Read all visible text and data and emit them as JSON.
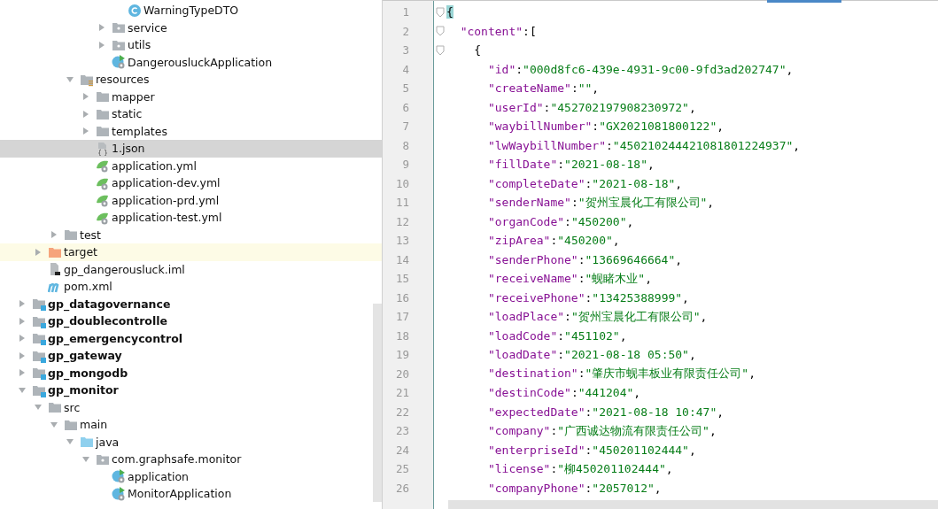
{
  "project_tree": [
    {
      "children": [
        {
          "children": [
            {
              "children": [
                {
                  "children": [
                    {
                      "children": [
                        {
                          "children": [
                            {
                              "label": "WarningTypeDTO",
                              "kind": "class",
                              "selected": false,
                              "highlighted": false
                            }
                          ]
                        },
                        {
                          "label": "service",
                          "kind": "package",
                          "expanded": false,
                          "selected": false,
                          "highlighted": false
                        },
                        {
                          "label": "utils",
                          "kind": "package",
                          "expanded": false,
                          "selected": false,
                          "highlighted": false
                        },
                        {
                          "label": "DangerousluckApplication",
                          "kind": "spring-class",
                          "selected": false,
                          "highlighted": false
                        }
                      ]
                    }
                  ]
                },
                {
                  "label": "resources",
                  "kind": "resources-folder",
                  "expanded": true,
                  "selected": false,
                  "highlighted": false,
                  "children": [
                    {
                      "label": "mapper",
                      "kind": "folder",
                      "expanded": false,
                      "selected": false,
                      "highlighted": false
                    },
                    {
                      "label": "static",
                      "kind": "folder",
                      "expanded": false,
                      "selected": false,
                      "highlighted": false
                    },
                    {
                      "label": "templates",
                      "kind": "folder",
                      "expanded": false,
                      "selected": false,
                      "highlighted": false
                    },
                    {
                      "label": "1.json",
                      "kind": "json",
                      "selected": true,
                      "highlighted": false
                    },
                    {
                      "label": "application.yml",
                      "kind": "spring-yml",
                      "selected": false,
                      "highlighted": false
                    },
                    {
                      "label": "application-dev.yml",
                      "kind": "spring-yml",
                      "selected": false,
                      "highlighted": false
                    },
                    {
                      "label": "application-prd.yml",
                      "kind": "spring-yml",
                      "selected": false,
                      "highlighted": false
                    },
                    {
                      "label": "application-test.yml",
                      "kind": "spring-yml",
                      "selected": false,
                      "highlighted": false
                    }
                  ]
                }
              ]
            },
            {
              "label": "test",
              "kind": "folder",
              "expanded": false,
              "selected": false,
              "highlighted": false
            }
          ]
        },
        {
          "label": "target",
          "kind": "excluded-folder",
          "expanded": false,
          "selected": false,
          "highlighted": true
        },
        {
          "label": "gp_dangerousluck.iml",
          "kind": "iml",
          "selected": false,
          "highlighted": false
        },
        {
          "label": "pom.xml",
          "kind": "maven",
          "selected": false,
          "highlighted": false
        }
      ]
    },
    {
      "label": "gp_datagovernance",
      "kind": "module",
      "expanded": false,
      "selected": false,
      "highlighted": false
    },
    {
      "label": "gp_doublecontrolle",
      "kind": "module",
      "expanded": false,
      "selected": false,
      "highlighted": false
    },
    {
      "label": "gp_emergencycontrol",
      "kind": "module",
      "expanded": false,
      "selected": false,
      "highlighted": false
    },
    {
      "label": "gp_gateway",
      "kind": "module",
      "expanded": false,
      "selected": false,
      "highlighted": false
    },
    {
      "label": "gp_mongodb",
      "kind": "module",
      "expanded": false,
      "selected": false,
      "highlighted": false
    },
    {
      "label": "gp_monitor",
      "kind": "module",
      "expanded": true,
      "selected": false,
      "highlighted": false,
      "children": [
        {
          "label": "src",
          "kind": "folder",
          "expanded": true,
          "selected": false,
          "highlighted": false,
          "children": [
            {
              "label": "main",
              "kind": "folder",
              "expanded": true,
              "selected": false,
              "highlighted": false,
              "children": [
                {
                  "label": "java",
                  "kind": "source-folder",
                  "expanded": true,
                  "selected": false,
                  "highlighted": false,
                  "children": [
                    {
                      "label": "com.graphsafe.monitor",
                      "kind": "package",
                      "expanded": true,
                      "selected": false,
                      "highlighted": false,
                      "children": [
                        {
                          "label": "application",
                          "kind": "spring-class",
                          "selected": false,
                          "highlighted": false
                        },
                        {
                          "label": "MonitorApplication",
                          "kind": "spring-class",
                          "selected": false,
                          "highlighted": false
                        }
                      ]
                    }
                  ]
                }
              ]
            }
          ]
        }
      ]
    }
  ],
  "editor": {
    "lines": [
      {
        "number": "1",
        "kind": "root-open",
        "tokens": [
          {
            "kind": "brace-match",
            "text": "{"
          }
        ]
      },
      {
        "number": "2",
        "kind": "array-open",
        "tokens": [
          {
            "kind": "key",
            "text": "\"content\""
          },
          {
            "kind": "punct",
            "text": ":["
          }
        ]
      },
      {
        "number": "3",
        "kind": "object-open",
        "tokens": [
          {
            "kind": "punct",
            "text": "{"
          }
        ]
      },
      {
        "number": "4",
        "kind": "field",
        "tokens": [
          {
            "kind": "key",
            "text": "\"id\""
          },
          {
            "kind": "punct",
            "text": ":"
          },
          {
            "kind": "value",
            "text": "\"000d8fc6-439e-4931-9c00-9fd3ad202747\""
          },
          {
            "kind": "punct",
            "text": ","
          }
        ]
      },
      {
        "number": "5",
        "kind": "field",
        "tokens": [
          {
            "kind": "key",
            "text": "\"createName\""
          },
          {
            "kind": "punct",
            "text": ":"
          },
          {
            "kind": "value",
            "text": "\"\""
          },
          {
            "kind": "punct",
            "text": ","
          }
        ]
      },
      {
        "number": "6",
        "kind": "field",
        "tokens": [
          {
            "kind": "key",
            "text": "\"userId\""
          },
          {
            "kind": "punct",
            "text": ":"
          },
          {
            "kind": "value",
            "text": "\"452702197908230972\""
          },
          {
            "kind": "punct",
            "text": ","
          }
        ]
      },
      {
        "number": "7",
        "kind": "field",
        "tokens": [
          {
            "kind": "key",
            "text": "\"waybillNumber\""
          },
          {
            "kind": "punct",
            "text": ":"
          },
          {
            "kind": "value",
            "text": "\"GX2021081800122\""
          },
          {
            "kind": "punct",
            "text": ","
          }
        ]
      },
      {
        "number": "8",
        "kind": "field",
        "tokens": [
          {
            "kind": "key",
            "text": "\"lwWaybillNumber\""
          },
          {
            "kind": "punct",
            "text": ":"
          },
          {
            "kind": "value",
            "text": "\"450210244421081801224937\""
          },
          {
            "kind": "punct",
            "text": ","
          }
        ]
      },
      {
        "number": "9",
        "kind": "field",
        "tokens": [
          {
            "kind": "key",
            "text": "\"fillDate\""
          },
          {
            "kind": "punct",
            "text": ":"
          },
          {
            "kind": "value",
            "text": "\"2021-08-18\""
          },
          {
            "kind": "punct",
            "text": ","
          }
        ]
      },
      {
        "number": "10",
        "kind": "field",
        "tokens": [
          {
            "kind": "key",
            "text": "\"completeDate\""
          },
          {
            "kind": "punct",
            "text": ":"
          },
          {
            "kind": "value",
            "text": "\"2021-08-18\""
          },
          {
            "kind": "punct",
            "text": ","
          }
        ]
      },
      {
        "number": "11",
        "kind": "field",
        "tokens": [
          {
            "kind": "key",
            "text": "\"senderName\""
          },
          {
            "kind": "punct",
            "text": ":"
          },
          {
            "kind": "value",
            "text": "\"贺州宝晨化工有限公司\""
          },
          {
            "kind": "punct",
            "text": ","
          }
        ]
      },
      {
        "number": "12",
        "kind": "field",
        "tokens": [
          {
            "kind": "key",
            "text": "\"organCode\""
          },
          {
            "kind": "punct",
            "text": ":"
          },
          {
            "kind": "value",
            "text": "\"450200\""
          },
          {
            "kind": "punct",
            "text": ","
          }
        ]
      },
      {
        "number": "13",
        "kind": "field",
        "tokens": [
          {
            "kind": "key",
            "text": "\"zipArea\""
          },
          {
            "kind": "punct",
            "text": ":"
          },
          {
            "kind": "value",
            "text": "\"450200\""
          },
          {
            "kind": "punct",
            "text": ","
          }
        ]
      },
      {
        "number": "14",
        "kind": "field",
        "tokens": [
          {
            "kind": "key",
            "text": "\"senderPhone\""
          },
          {
            "kind": "punct",
            "text": ":"
          },
          {
            "kind": "value",
            "text": "\"13669646664\""
          },
          {
            "kind": "punct",
            "text": ","
          }
        ]
      },
      {
        "number": "15",
        "kind": "field",
        "tokens": [
          {
            "kind": "key",
            "text": "\"receiveName\""
          },
          {
            "kind": "punct",
            "text": ":"
          },
          {
            "kind": "value",
            "text": "\"蚬睹木业\""
          },
          {
            "kind": "punct",
            "text": ","
          }
        ]
      },
      {
        "number": "16",
        "kind": "field",
        "tokens": [
          {
            "kind": "key",
            "text": "\"receivePhone\""
          },
          {
            "kind": "punct",
            "text": ":"
          },
          {
            "kind": "value",
            "text": "\"13425388999\""
          },
          {
            "kind": "punct",
            "text": ","
          }
        ]
      },
      {
        "number": "17",
        "kind": "field",
        "tokens": [
          {
            "kind": "key",
            "text": "\"loadPlace\""
          },
          {
            "kind": "punct",
            "text": ":"
          },
          {
            "kind": "value",
            "text": "\"贺州宝晨化工有限公司\""
          },
          {
            "kind": "punct",
            "text": ","
          }
        ]
      },
      {
        "number": "18",
        "kind": "field",
        "tokens": [
          {
            "kind": "key",
            "text": "\"loadCode\""
          },
          {
            "kind": "punct",
            "text": ":"
          },
          {
            "kind": "value",
            "text": "\"451102\""
          },
          {
            "kind": "punct",
            "text": ","
          }
        ]
      },
      {
        "number": "19",
        "kind": "field",
        "tokens": [
          {
            "kind": "key",
            "text": "\"loadDate\""
          },
          {
            "kind": "punct",
            "text": ":"
          },
          {
            "kind": "value",
            "text": "\"2021-08-18 05:50\""
          },
          {
            "kind": "punct",
            "text": ","
          }
        ]
      },
      {
        "number": "20",
        "kind": "field",
        "tokens": [
          {
            "kind": "key",
            "text": "\"destination\""
          },
          {
            "kind": "punct",
            "text": ":"
          },
          {
            "kind": "value",
            "text": "\"肇庆市蚬丰板业有限责任公司\""
          },
          {
            "kind": "punct",
            "text": ","
          }
        ]
      },
      {
        "number": "21",
        "kind": "field",
        "tokens": [
          {
            "kind": "key",
            "text": "\"destinCode\""
          },
          {
            "kind": "punct",
            "text": ":"
          },
          {
            "kind": "value",
            "text": "\"441204\""
          },
          {
            "kind": "punct",
            "text": ","
          }
        ]
      },
      {
        "number": "22",
        "kind": "field",
        "tokens": [
          {
            "kind": "key",
            "text": "\"expectedDate\""
          },
          {
            "kind": "punct",
            "text": ":"
          },
          {
            "kind": "value",
            "text": "\"2021-08-18 10:47\""
          },
          {
            "kind": "punct",
            "text": ","
          }
        ]
      },
      {
        "number": "23",
        "kind": "field",
        "tokens": [
          {
            "kind": "key",
            "text": "\"company\""
          },
          {
            "kind": "punct",
            "text": ":"
          },
          {
            "kind": "value",
            "text": "\"广西诚达物流有限责任公司\""
          },
          {
            "kind": "punct",
            "text": ","
          }
        ]
      },
      {
        "number": "24",
        "kind": "field",
        "tokens": [
          {
            "kind": "key",
            "text": "\"enterpriseId\""
          },
          {
            "kind": "punct",
            "text": ":"
          },
          {
            "kind": "value",
            "text": "\"450201102444\""
          },
          {
            "kind": "punct",
            "text": ","
          }
        ]
      },
      {
        "number": "25",
        "kind": "field",
        "tokens": [
          {
            "kind": "key",
            "text": "\"license\""
          },
          {
            "kind": "punct",
            "text": ":"
          },
          {
            "kind": "value",
            "text": "\"柳450201102444\""
          },
          {
            "kind": "punct",
            "text": ","
          }
        ]
      },
      {
        "number": "26",
        "kind": "field",
        "tokens": [
          {
            "kind": "key",
            "text": "\"companyPhone\""
          },
          {
            "kind": "punct",
            "text": ":"
          },
          {
            "kind": "value",
            "text": "\"2057012\""
          },
          {
            "kind": "punct",
            "text": ","
          }
        ]
      }
    ]
  }
}
